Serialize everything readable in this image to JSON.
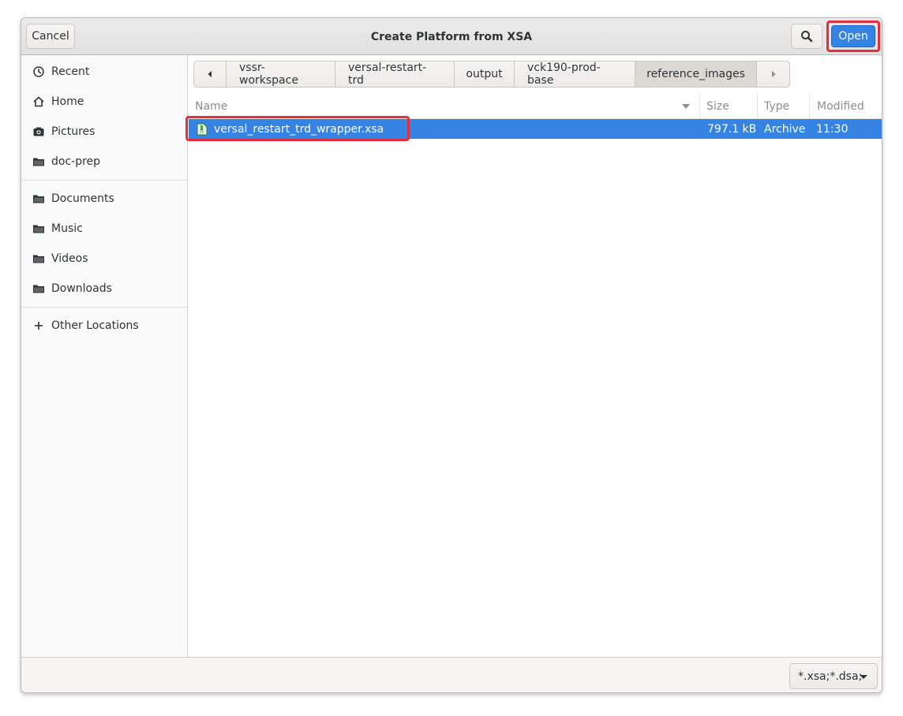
{
  "dialog": {
    "title": "Create Platform from XSA",
    "cancel_label": "Cancel",
    "open_label": "Open"
  },
  "sidebar": {
    "items": [
      {
        "label": "Recent",
        "icon": "clock-icon"
      },
      {
        "label": "Home",
        "icon": "home-icon"
      },
      {
        "label": "Pictures",
        "icon": "camera-icon"
      },
      {
        "label": "doc-prep",
        "icon": "folder-icon"
      },
      {
        "label": "Documents",
        "icon": "folder-icon"
      },
      {
        "label": "Music",
        "icon": "folder-icon"
      },
      {
        "label": "Videos",
        "icon": "folder-icon"
      },
      {
        "label": "Downloads",
        "icon": "folder-icon"
      },
      {
        "label": "Other Locations",
        "icon": "plus-icon"
      }
    ]
  },
  "pathbar": {
    "crumbs": [
      "vssr-workspace",
      "versal-restart-trd",
      "output",
      "vck190-prod-base",
      "reference_images"
    ],
    "active_index": 4
  },
  "filelist": {
    "columns": {
      "name": "Name",
      "size": "Size",
      "type": "Type",
      "modified": "Modified"
    },
    "rows": [
      {
        "name": "versal_restart_trd_wrapper.xsa",
        "size": "797.1 kB",
        "type": "Archive",
        "modified": "11:30",
        "selected": true
      }
    ]
  },
  "filter": {
    "value": "*.xsa;*.dsa;"
  },
  "colors": {
    "accent": "#3584e4",
    "highlight": "#e0303b"
  }
}
